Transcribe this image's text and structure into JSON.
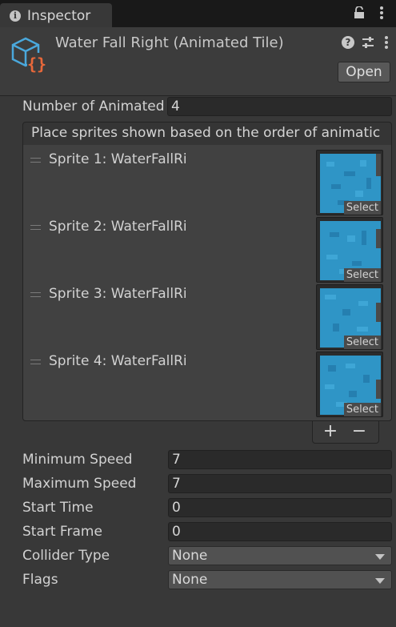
{
  "tab": {
    "label": "Inspector"
  },
  "header": {
    "title": "Water Fall Right (Animated Tile)",
    "open_label": "Open",
    "icons": [
      "info-icon",
      "lock-icon",
      "more-icon",
      "animated-tile-icon",
      "help-icon",
      "preset-icon"
    ]
  },
  "number_of_animated": {
    "label": "Number of Animated",
    "value": "4"
  },
  "sprite_list": {
    "header": "Place sprites shown based on the order of animatic",
    "select_label": "Select",
    "items": [
      {
        "label": "Sprite 1: WaterFallRi"
      },
      {
        "label": "Sprite 2: WaterFallRi"
      },
      {
        "label": "Sprite 3: WaterFallRi"
      },
      {
        "label": "Sprite 4: WaterFallRi"
      }
    ],
    "add_label": "+",
    "remove_label": "−"
  },
  "fields": {
    "minimum_speed": {
      "label": "Minimum Speed",
      "value": "7"
    },
    "maximum_speed": {
      "label": "Maximum Speed",
      "value": "7"
    },
    "start_time": {
      "label": "Start Time",
      "value": "0"
    },
    "start_frame": {
      "label": "Start Frame",
      "value": "0"
    },
    "collider_type": {
      "label": "Collider Type",
      "value": "None"
    },
    "flags": {
      "label": "Flags",
      "value": "None"
    }
  },
  "colors": {
    "background": "#383838",
    "field_bg": "#2a2a2a",
    "water": "#2f95c6",
    "accent_orange": "#e8683a",
    "accent_blue": "#4aa8dc"
  }
}
